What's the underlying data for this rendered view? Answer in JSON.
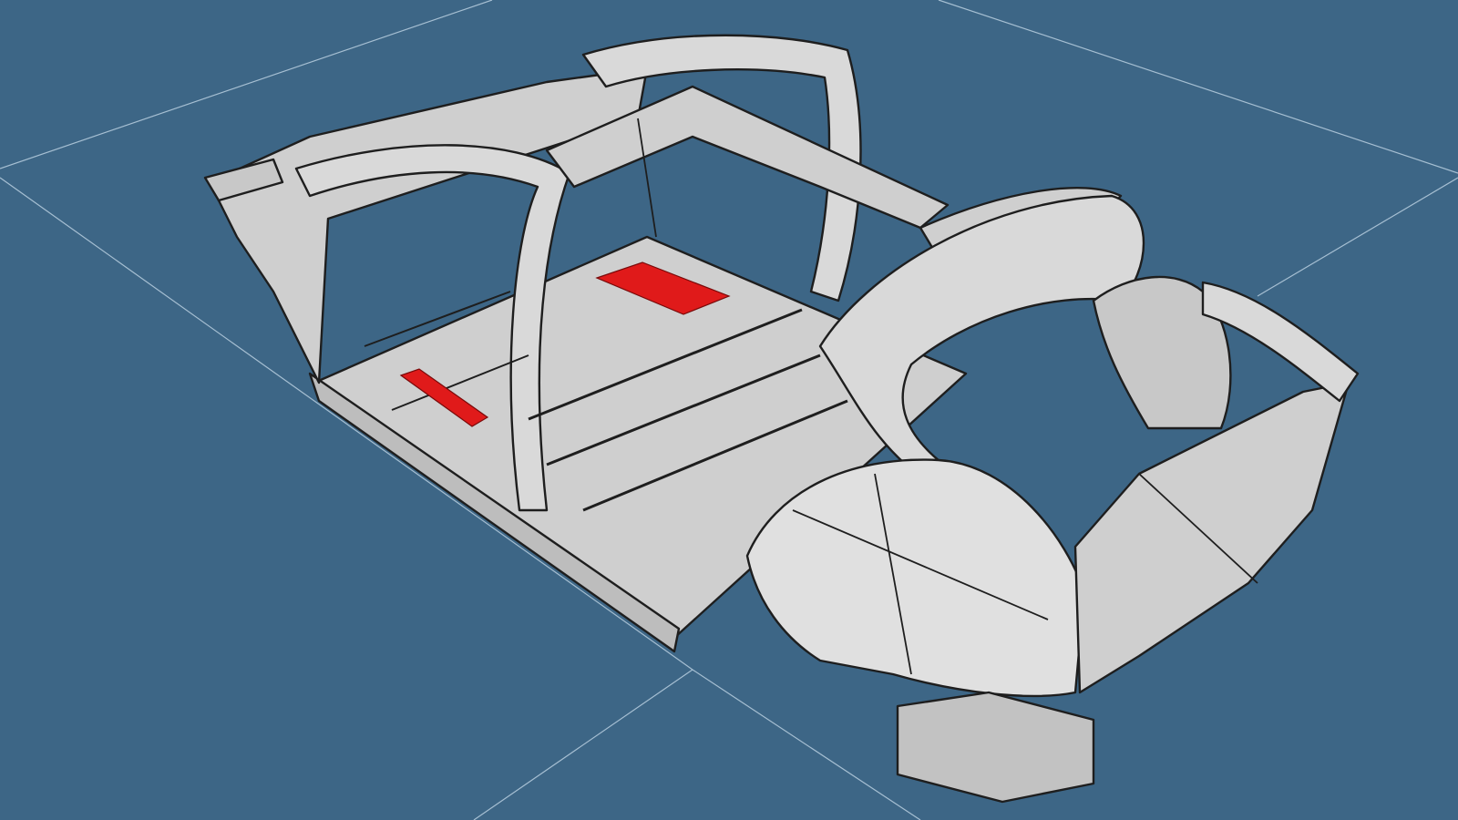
{
  "viewport": {
    "background_color": "#3d6686",
    "grid_color": "#b9cfe0",
    "model_fill": "#d6d6d6",
    "model_fill_shade": "#bdbdbd",
    "model_outline": "#1e1e1e",
    "highlight_color": "#e01a1a",
    "model": {
      "name_icon": "car-body-in-white-model",
      "highlighted_parts_count": 2
    }
  }
}
